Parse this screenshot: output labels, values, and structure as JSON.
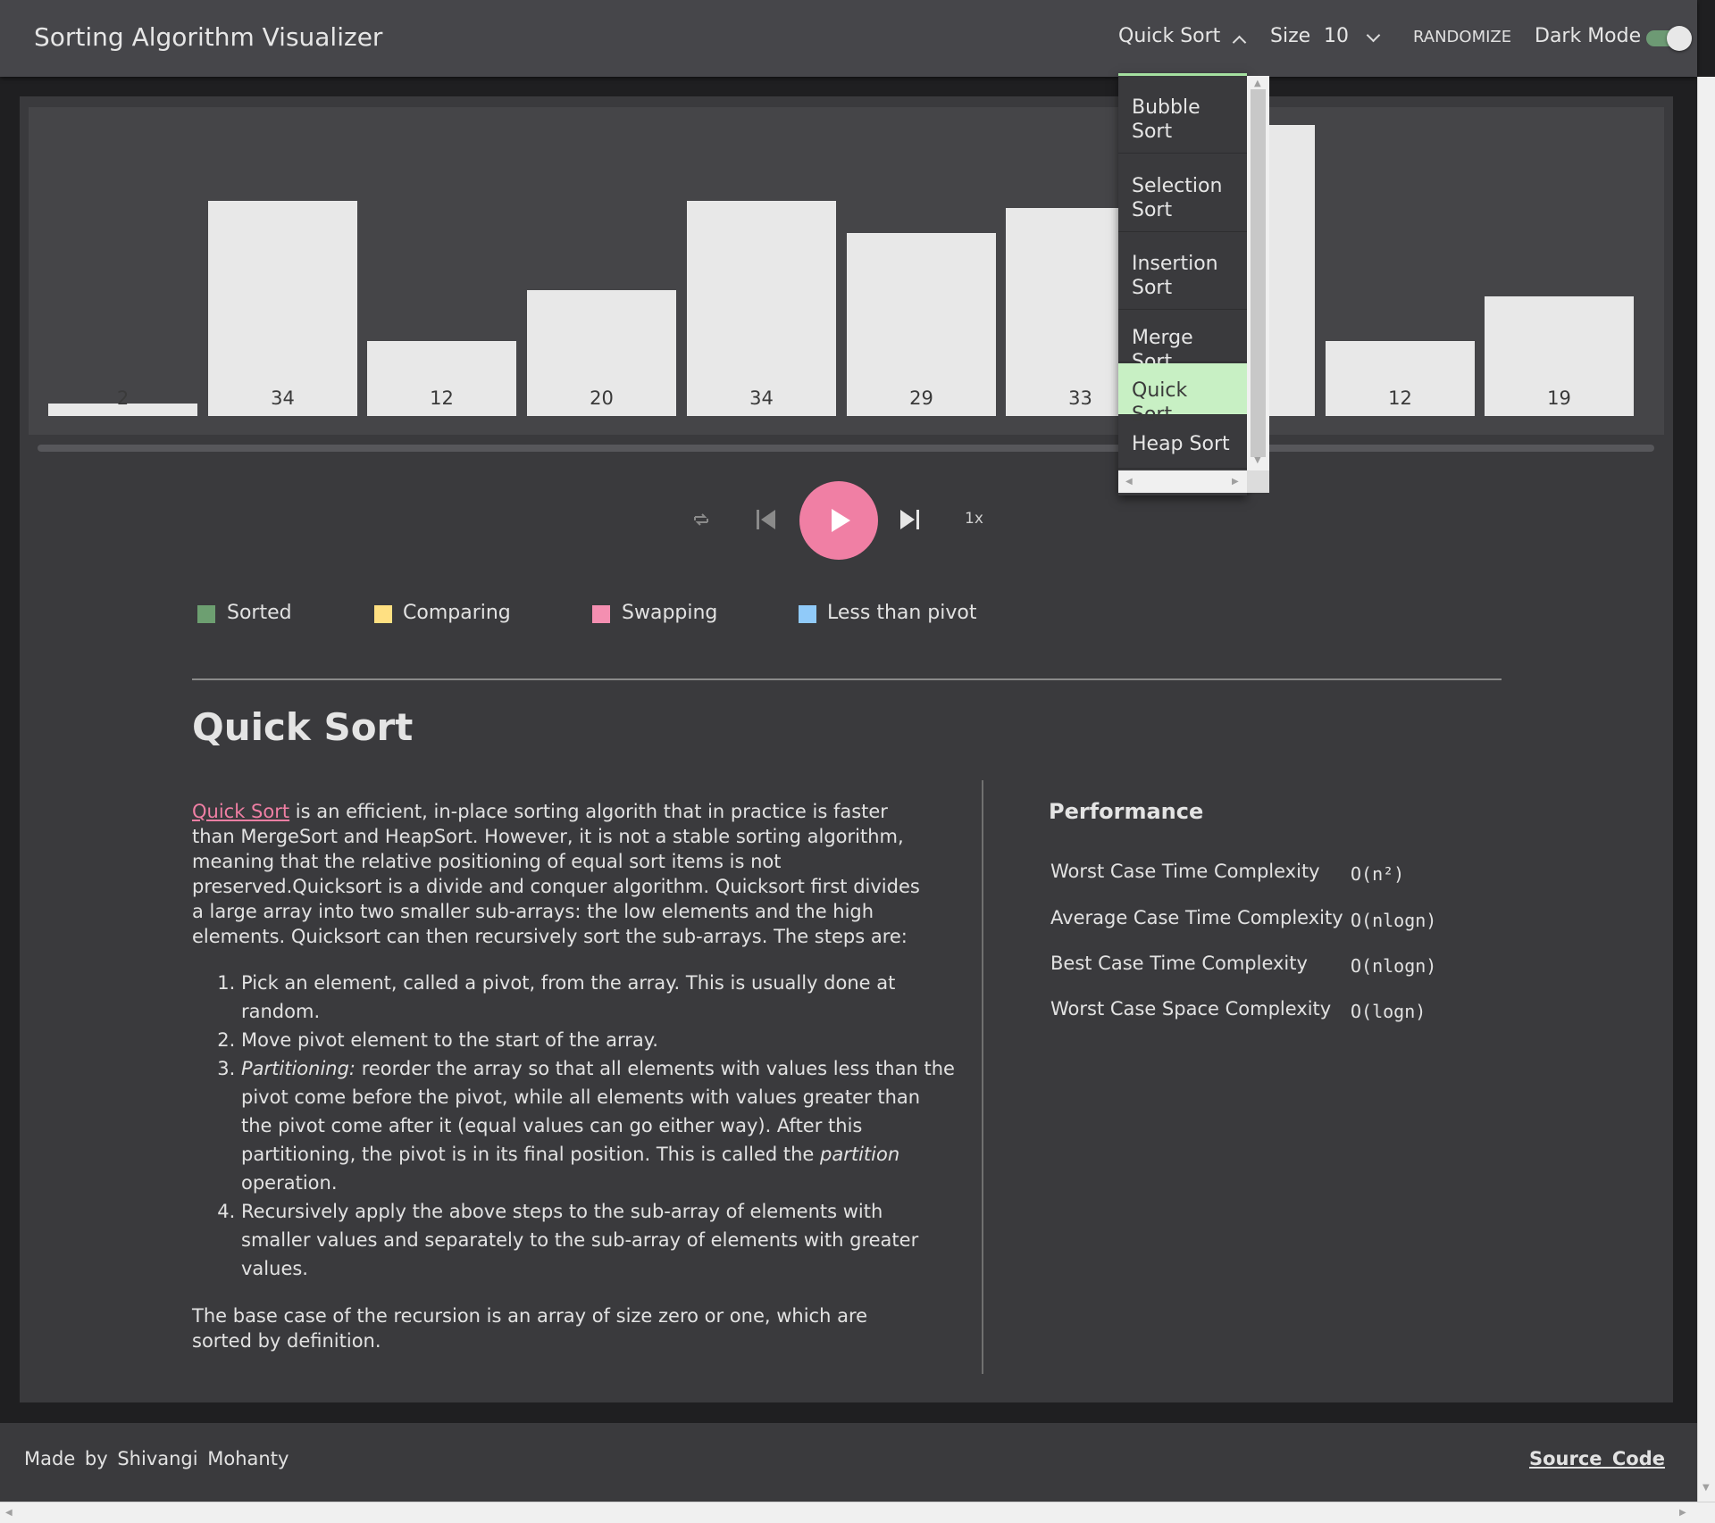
{
  "header": {
    "title": "Sorting Algorithm Visualizer",
    "algorithm_selected": "Quick Sort",
    "size_label": "Size",
    "size_value": "10",
    "randomize_label": "RANDOMIZE",
    "dark_mode_label": "Dark Mode",
    "dark_mode_on": true
  },
  "dropdown": {
    "items": [
      "Bubble Sort",
      "Selection Sort",
      "Insertion Sort",
      "Merge Sort",
      "Quick Sort",
      "Heap Sort"
    ],
    "selected": "Quick Sort"
  },
  "bars": {
    "labels": [
      "2",
      "34",
      "12",
      "20",
      "34",
      "29",
      "33",
      "",
      "12",
      "19"
    ]
  },
  "controls": {
    "speed": "1x",
    "progress": 0
  },
  "legend": {
    "items": [
      {
        "label": "Sorted",
        "color": "#6d9f71"
      },
      {
        "label": "Comparing",
        "color": "#ffe082"
      },
      {
        "label": "Swapping",
        "color": "#f48fb1"
      },
      {
        "label": "Less than pivot",
        "color": "#90caf9"
      }
    ]
  },
  "description": {
    "title": "Quick Sort",
    "link_text": "Quick Sort",
    "intro": " is an efficient, in-place sorting algorith that in practice is faster than MergeSort and HeapSort. However, it is not a stable sorting algorithm, meaning that the relative positioning of equal sort items is not preserved.Quicksort is a divide and conquer algorithm. Quicksort first divides a large array into two smaller sub-arrays: the low elements and the high elements. Quicksort can then recursively sort the sub-arrays. The steps are:",
    "step1": "Pick an element, called a pivot, from the array. This is usually done at random.",
    "step2": "Move pivot element to the start of the array.",
    "step3_em": "Partitioning:",
    "step3_text": " reorder the array so that all elements with values less than the pivot come before the pivot, while all elements with values greater than the pivot come after it (equal values can go either way). After this partitioning, the pivot is in its final position. This is called the ",
    "step3_em2": "partition",
    "step3_end": " operation.",
    "step4": "Recursively apply the above steps to the sub-array of elements with smaller values and separately to the sub-array of elements with greater values.",
    "base_case": "The base case of the recursion is an array of size zero or one, which are sorted by definition."
  },
  "performance": {
    "title": "Performance",
    "rows": [
      {
        "label": "Worst Case Time Complexity",
        "value": "O(n²)"
      },
      {
        "label": "Average Case Time Complexity",
        "value": "O(nlogn)"
      },
      {
        "label": "Best Case Time Complexity",
        "value": "O(nlogn)"
      },
      {
        "label": "Worst Case Space Complexity",
        "value": "O(logn)"
      }
    ]
  },
  "footer": {
    "credit": "Made by Shivangi Mohanty",
    "source_link": "Source Code"
  },
  "icons": [
    "repeat-icon",
    "skip-back-icon",
    "play-icon",
    "skip-forward-icon",
    "chevron-up-icon",
    "chevron-down-icon"
  ]
}
